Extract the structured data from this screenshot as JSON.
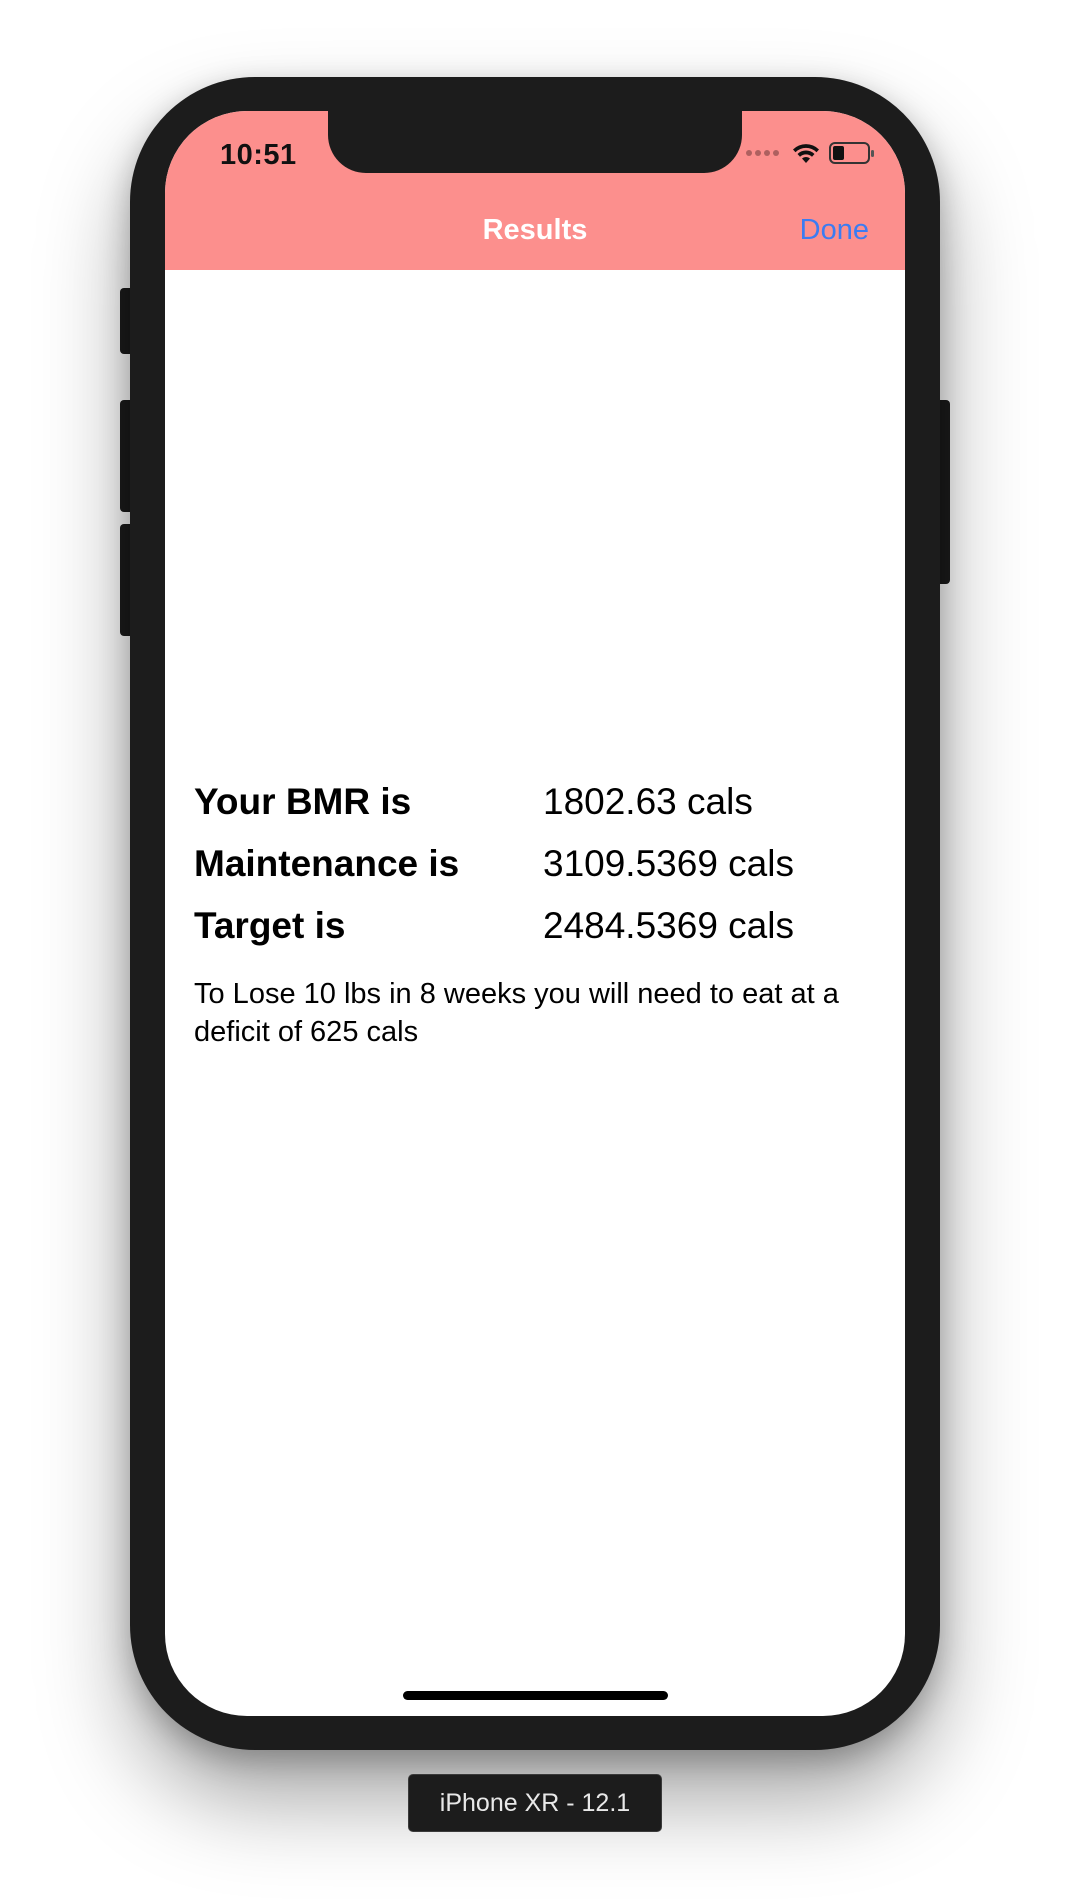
{
  "status_bar": {
    "time": "10:51",
    "icons": [
      "signal-dots-icon",
      "wifi-icon",
      "battery-icon"
    ]
  },
  "nav": {
    "title": "Results",
    "done_label": "Done"
  },
  "results": [
    {
      "label": "Your BMR is",
      "value": "1802.63 cals"
    },
    {
      "label": "Maintenance is",
      "value": "3109.5369 cals"
    },
    {
      "label": "Target is",
      "value": "2484.5369 cals"
    }
  ],
  "note": "To Lose 10 lbs in 8 weeks you will need to eat at a deficit of 625 cals",
  "simulator": {
    "device_label": "iPhone XR - 12.1"
  },
  "colors": {
    "navbar": "#fc8f8d",
    "done_link": "#3b7cf2",
    "device_frame": "#1c1c1c"
  }
}
